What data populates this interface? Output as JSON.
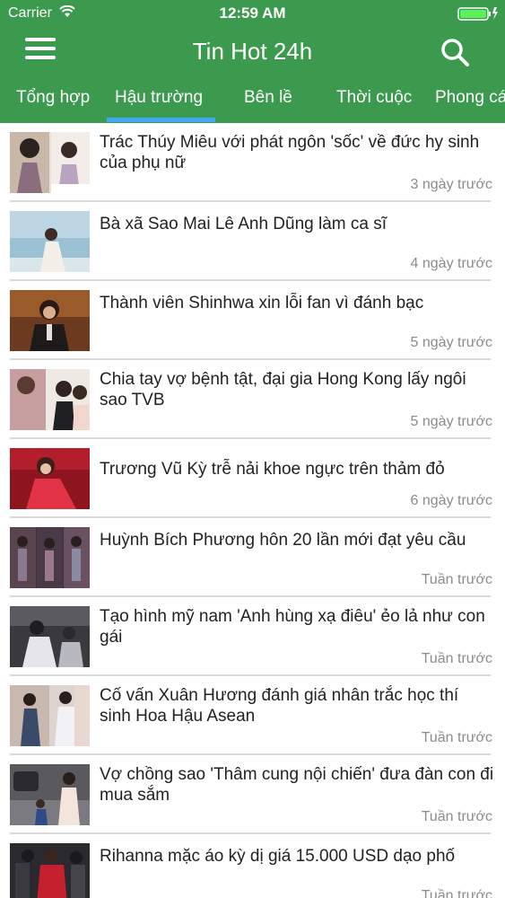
{
  "status_bar": {
    "carrier": "Carrier",
    "time": "12:59 AM"
  },
  "header": {
    "title": "Tin Hot 24h"
  },
  "tabs": [
    {
      "label": "Tổng hợp"
    },
    {
      "label": "Hậu trường",
      "active": true
    },
    {
      "label": "Bên lề"
    },
    {
      "label": "Thời cuộc"
    },
    {
      "label": "Phong cách"
    }
  ],
  "articles": [
    {
      "title": "Trác Thúy Miêu với phát ngôn 'sốc' về đức hy sinh của phụ nữ",
      "time": "3 ngày trước"
    },
    {
      "title": "Bà xã Sao Mai Lê Anh Dũng làm ca sĩ",
      "time": "4 ngày trước"
    },
    {
      "title": "Thành viên Shinhwa xin lỗi fan vì đánh bạc",
      "time": "5 ngày trước"
    },
    {
      "title": "Chia tay vợ bệnh tật, đại gia Hong Kong lấy ngôi sao TVB",
      "time": "5 ngày trước"
    },
    {
      "title": "Trương Vũ Kỳ trễ nải khoe ngực trên thảm đỏ",
      "time": "6 ngày trước"
    },
    {
      "title": "Huỳnh Bích Phương hôn 20 lần mới đạt yêu cầu",
      "time": "Tuần trước"
    },
    {
      "title": "Tạo hình mỹ nam 'Anh hùng xạ điêu' ẻo lả như con gái",
      "time": "Tuần trước"
    },
    {
      "title": "Cố vấn Xuân Hương đánh giá nhân trắc học thí sinh Hoa Hậu Asean",
      "time": "Tuần trước"
    },
    {
      "title": "Vợ chồng sao 'Thâm cung nội chiến' đưa đàn con đi mua sắm",
      "time": "Tuần trước"
    },
    {
      "title": "Rihanna mặc áo kỳ dị giá 15.000 USD dạo phố",
      "time": "Tuần trước"
    }
  ],
  "colors": {
    "header": "#3c9a4e",
    "tab_indicator": "#3fa9f5",
    "time_text": "#8c8c8c"
  }
}
